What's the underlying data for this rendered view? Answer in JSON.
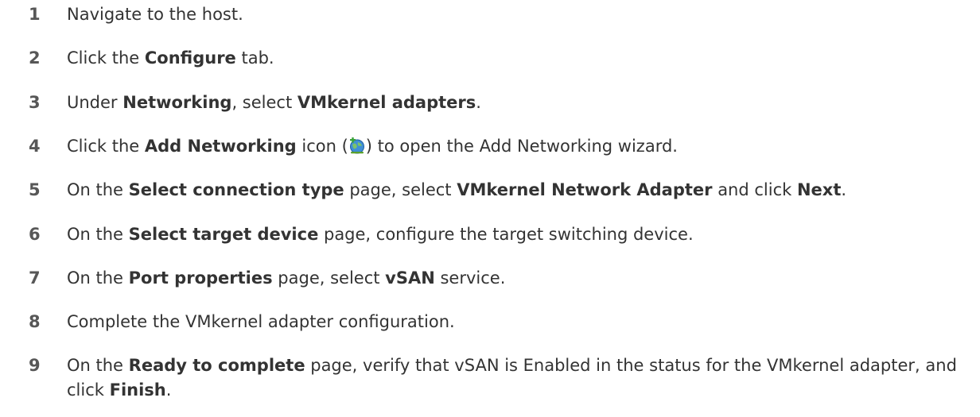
{
  "steps": [
    {
      "number": "1",
      "parts": [
        {
          "t": "Navigate to the host."
        }
      ]
    },
    {
      "number": "2",
      "parts": [
        {
          "t": "Click the "
        },
        {
          "b": "Configure"
        },
        {
          "t": " tab."
        }
      ]
    },
    {
      "number": "3",
      "parts": [
        {
          "t": "Under "
        },
        {
          "b": "Networking"
        },
        {
          "t": ", select "
        },
        {
          "b": "VMkernel adapters"
        },
        {
          "t": "."
        }
      ]
    },
    {
      "number": "4",
      "parts": [
        {
          "t": "Click the "
        },
        {
          "b": "Add Networking"
        },
        {
          "t": " icon ("
        },
        {
          "icon": "add-networking-icon"
        },
        {
          "t": ") to open the Add Networking wizard."
        }
      ]
    },
    {
      "number": "5",
      "parts": [
        {
          "t": "On the "
        },
        {
          "b": "Select connection type"
        },
        {
          "t": " page, select "
        },
        {
          "b": "VMkernel Network Adapter"
        },
        {
          "t": " and click "
        },
        {
          "b": "Next"
        },
        {
          "t": "."
        }
      ]
    },
    {
      "number": "6",
      "parts": [
        {
          "t": "On the "
        },
        {
          "b": "Select target device"
        },
        {
          "t": " page, configure the target switching device."
        }
      ]
    },
    {
      "number": "7",
      "parts": [
        {
          "t": "On the "
        },
        {
          "b": "Port properties"
        },
        {
          "t": " page, select "
        },
        {
          "b": "vSAN"
        },
        {
          "t": " service."
        }
      ]
    },
    {
      "number": "8",
      "parts": [
        {
          "t": "Complete the VMkernel adapter configuration."
        }
      ]
    },
    {
      "number": "9",
      "parts": [
        {
          "t": "On the "
        },
        {
          "b": "Ready to complete"
        },
        {
          "t": " page, verify that vSAN is Enabled in the status for the VMkernel adapter, and click "
        },
        {
          "b": "Finish"
        },
        {
          "t": "."
        }
      ]
    }
  ]
}
